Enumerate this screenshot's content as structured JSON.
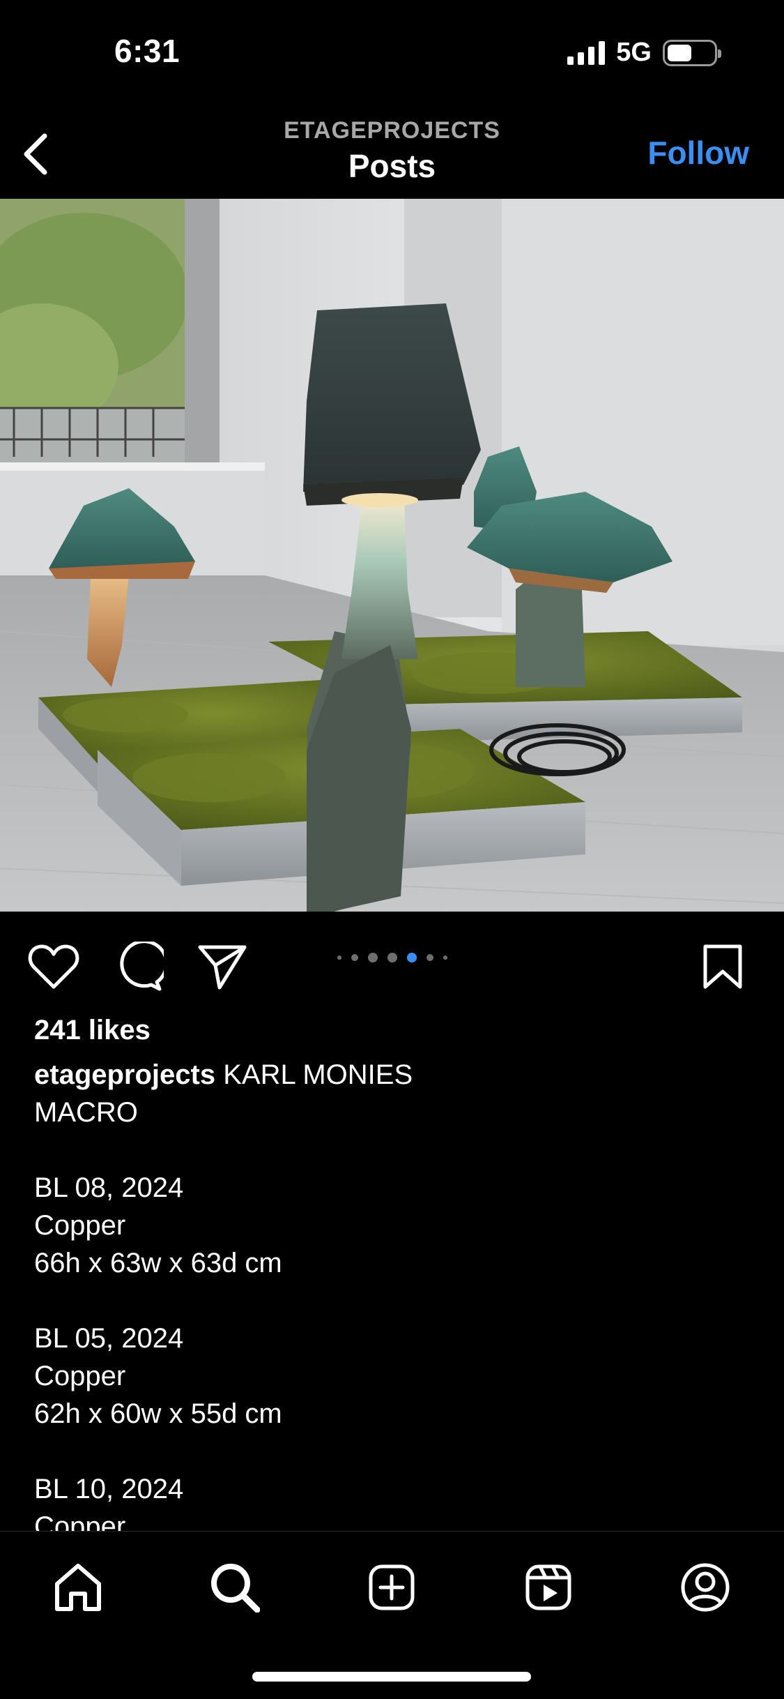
{
  "status_bar": {
    "time": "6:31",
    "network": "5G"
  },
  "header": {
    "account": "ETAGEPROJECTS",
    "title": "Posts",
    "follow_label": "Follow"
  },
  "post": {
    "carousel": {
      "total": 7,
      "active_index": 4
    },
    "likes": "241 likes",
    "caption_user": "etageprojects",
    "caption_first": " KARL MONIES",
    "caption_lines": [
      "MACRO",
      "",
      "BL 08, 2024",
      "Copper",
      "66h x 63w x 63d cm",
      "",
      "BL 05, 2024",
      "Copper",
      "62h x 60w x 55d cm",
      "",
      "BL 10, 2024",
      "Copper"
    ]
  },
  "icons": {
    "back": "chevron-left-icon",
    "like": "heart-icon",
    "comment": "comment-icon",
    "share": "paper-plane-icon",
    "save": "bookmark-icon",
    "tabs": [
      "home-icon",
      "search-icon",
      "create-icon",
      "reels-icon",
      "profile-icon"
    ]
  },
  "colors": {
    "accent": "#3b8ff2",
    "background": "#000000",
    "muted": "#a8a8a8"
  }
}
